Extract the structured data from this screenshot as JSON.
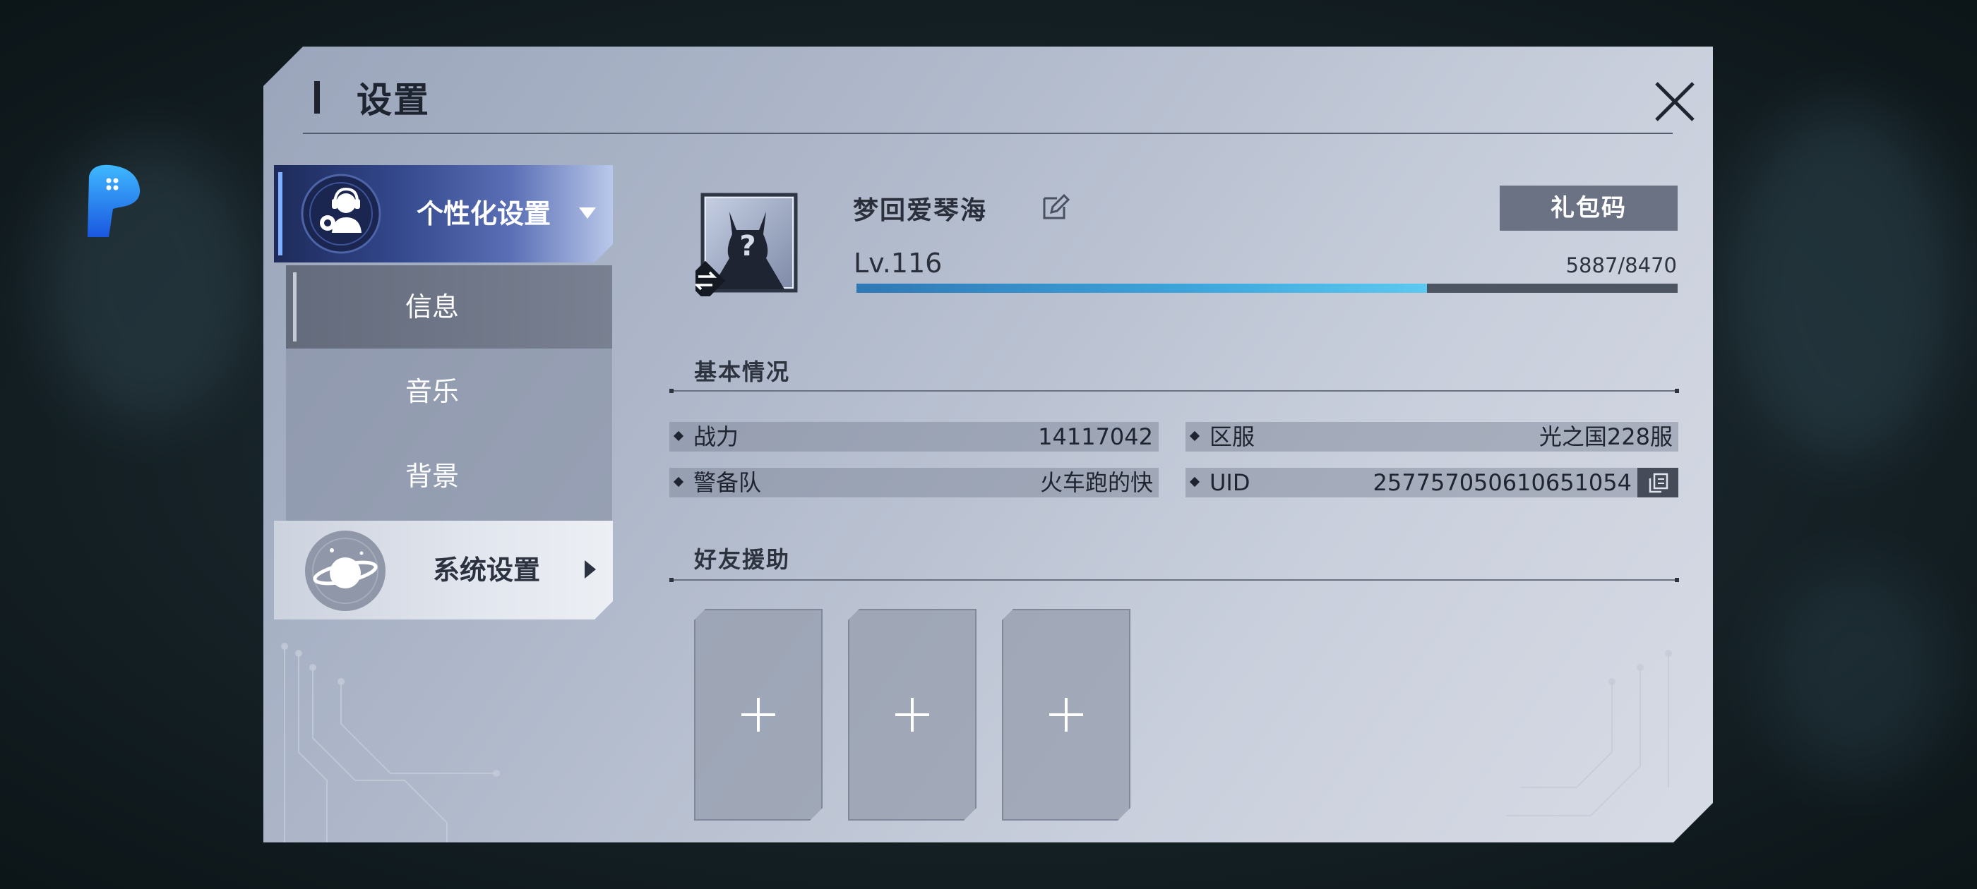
{
  "panel": {
    "title": "设置"
  },
  "nav": {
    "personal_label": "个性化设置",
    "sub_items": [
      {
        "label": "信息",
        "active": true
      },
      {
        "label": "音乐",
        "active": false
      },
      {
        "label": "背景",
        "active": false
      }
    ],
    "system_label": "系统设置"
  },
  "profile": {
    "name": "梦回爱琴海",
    "gift_code_label": "礼包码",
    "level": "Lv.116",
    "exp_text": "5887/8470",
    "exp_fraction": 0.695
  },
  "basic": {
    "section_title": "基本情况",
    "stats": [
      {
        "key": "战力",
        "value": "14117042"
      },
      {
        "key": "区服",
        "value": "光之国228服"
      },
      {
        "key": "警备队",
        "value": "火车跑的快"
      },
      {
        "key": "UID",
        "value": "257757050610651054"
      }
    ]
  },
  "friends": {
    "section_title": "好友援助",
    "slots": [
      "+",
      "+",
      "+"
    ]
  },
  "colors": {
    "panel": "#b3bccd",
    "accent_blue": "#3ea6dc",
    "nav_active": "#32468a",
    "button_gray": "#6b7283"
  },
  "icons": [
    "assistant-float-icon",
    "close-icon",
    "gear-headset-icon",
    "planet-icon",
    "avatar-placeholder-icon",
    "swap-icon",
    "edit-icon",
    "copy-icon",
    "plus-icon"
  ]
}
